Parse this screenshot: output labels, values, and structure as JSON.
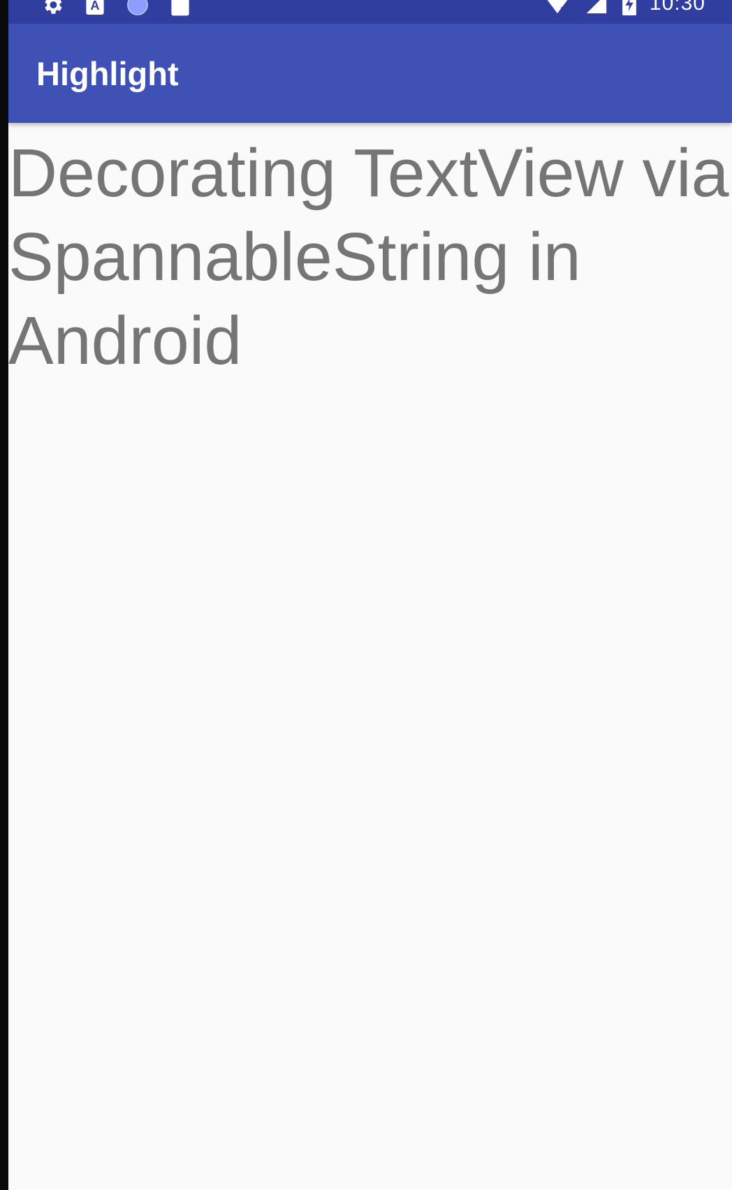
{
  "status_bar": {
    "time": "10:30",
    "left_icons": [
      "settings-icon",
      "text-a-icon",
      "circle-icon",
      "sd-card-icon"
    ],
    "right_icons": [
      "wifi-off-icon",
      "signal-icon",
      "battery-charging-icon"
    ]
  },
  "app_bar": {
    "title": "Highlight"
  },
  "main": {
    "text": "Decorating TextView via SpannableString in Android"
  },
  "colors": {
    "status_bar": "#303f9f",
    "app_bar": "#3f51b5",
    "background": "#fafafa",
    "text": "#757575"
  }
}
